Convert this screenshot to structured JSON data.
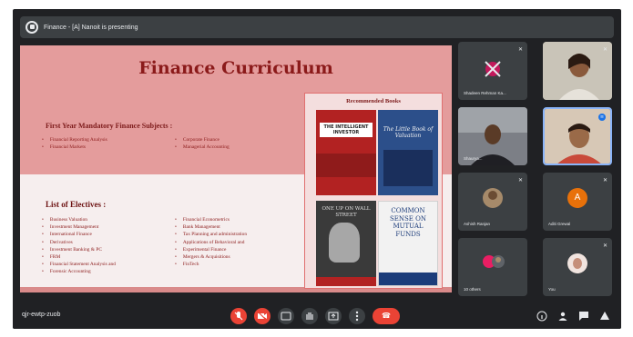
{
  "presentation_banner": {
    "text": "Finance - [A] Nanoit is presenting"
  },
  "slide": {
    "title": "Finance Curriculum",
    "mandatory_heading": "First Year Mandatory Finance Subjects :",
    "mandatory_left": [
      "Financial Reporting Analysis",
      "Financial Markets"
    ],
    "mandatory_right": [
      "Corporate Finance",
      "Managerial Accounting"
    ],
    "electives_heading": "List of Electives :",
    "electives_left": [
      "Business Valuation",
      "Investment Management",
      "International Finance",
      "Derivatives",
      "Investment Banking & PC",
      "FRM",
      "Financial Statement Analysis and",
      "Forensic Accounting"
    ],
    "electives_right": [
      "Financial Econometrics",
      "Bank Management",
      "Tax Planning and administration",
      "Applications of Behavioral and",
      "Experimental Finance",
      "Mergers & Acquisitions",
      "FinTech"
    ],
    "recommended_heading": "Recommended Books",
    "books": [
      {
        "title": "THE INTELLIGENT INVESTOR"
      },
      {
        "title": "The Little Book of Valuation"
      },
      {
        "title": "ONE UP ON WALL STREET"
      },
      {
        "title": "COMMON SENSE ON MUTUAL FUNDS"
      }
    ]
  },
  "participants": [
    {
      "name": "Shadeen Rehman Ka..."
    },
    {
      "name": ""
    },
    {
      "name": "Shaurya..."
    },
    {
      "name": ""
    },
    {
      "name": "Ashish Ranjan",
      "initial": ""
    },
    {
      "name": "Aditi Grewal",
      "initial": "A"
    },
    {
      "name": "10 others"
    },
    {
      "name": "You"
    }
  ],
  "bottom_bar": {
    "meeting_code": "qjr-ewtp-zuob",
    "controls": [
      "mic-off",
      "camera-off",
      "captions",
      "raise-hand",
      "present",
      "more"
    ],
    "end_call_icon": "☎"
  },
  "colors": {
    "slide_title": "#8b1a1a",
    "slide_top_bg": "#e49c9c",
    "end_call": "#ea4335",
    "meet_bg": "#202124"
  }
}
